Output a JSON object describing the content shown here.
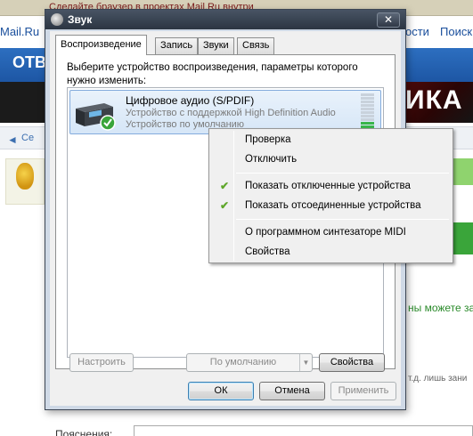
{
  "background": {
    "banner_text": "Сделайте браузер в проектах Mail.Ru внутри",
    "nav": {
      "mailru": "Mail.Ru",
      "link1": "ости",
      "link2": "Поиск"
    },
    "header": {
      "otv": "ОТВ",
      "ika": "ИКА"
    },
    "strip_text": "Се",
    "green_text": "ны можете зад",
    "gray_text": "т.д. лишь зани",
    "bottom_label": "Пояснения:"
  },
  "dialog": {
    "title": "Звук",
    "close_glyph": "✕",
    "tabs": [
      {
        "label": "Воспроизведение",
        "active": true
      },
      {
        "label": "Запись",
        "active": false
      },
      {
        "label": "Звуки",
        "active": false
      },
      {
        "label": "Связь",
        "active": false
      }
    ],
    "instruction": "Выберите устройство воспроизведения, параметры которого нужно изменить:",
    "device": {
      "name": "Цифровое аудио (S/PDIF)",
      "description": "Устройство с поддержкой High Definition Audio",
      "status": "Устройство по умолчанию",
      "level_fraction": 0.3
    },
    "buttons": {
      "configure": "Настроить",
      "set_default": "По умолчанию",
      "properties": "Свойства",
      "ok": "ОК",
      "cancel": "Отмена",
      "apply": "Применить"
    }
  },
  "context_menu": {
    "items": [
      {
        "label": "Проверка",
        "checked": false
      },
      {
        "label": "Отключить",
        "checked": false
      },
      {
        "label": "Показать отключенные устройства",
        "checked": true
      },
      {
        "label": "Показать отсоединенные устройства",
        "checked": true
      },
      {
        "label": "О программном синтезаторе MIDI",
        "checked": false
      },
      {
        "label": "Свойства",
        "checked": false
      }
    ],
    "check_glyph": "✔"
  },
  "colors": {
    "title_bar": "#2c3542",
    "selection": "#d6e6f7",
    "level_on": "#39b54a",
    "check": "#5fa72c"
  }
}
